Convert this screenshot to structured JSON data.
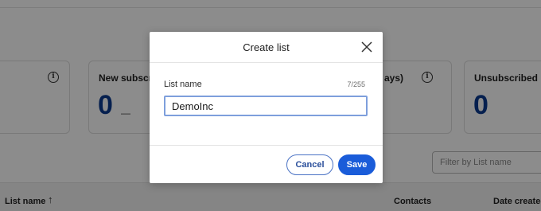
{
  "background": {
    "cards": [
      {
        "title": "",
        "value": "",
        "has_info": true
      },
      {
        "title": "New subscrib",
        "value": "0",
        "trend": "—",
        "has_info": false
      },
      {
        "title": "ays)",
        "value": "",
        "has_info": true
      },
      {
        "title": "Unsubscribed",
        "value": "0",
        "has_info": false
      }
    ],
    "filter_placeholder": "Filter by List name",
    "table_headers": {
      "list_name": "List name",
      "contacts": "Contacts",
      "date_created": "Date created"
    }
  },
  "modal": {
    "title": "Create list",
    "field_label": "List name",
    "counter": "7/255",
    "input_value": "DemoInc",
    "cancel_label": "Cancel",
    "save_label": "Save"
  },
  "colors": {
    "primary": "#1a5cd9",
    "value_blue": "#0b3b91",
    "overlay": "rgba(0,0,0,0.45)"
  },
  "icons": {
    "close": "close-icon",
    "info": "info-icon",
    "sort": "arrow-up-icon"
  }
}
